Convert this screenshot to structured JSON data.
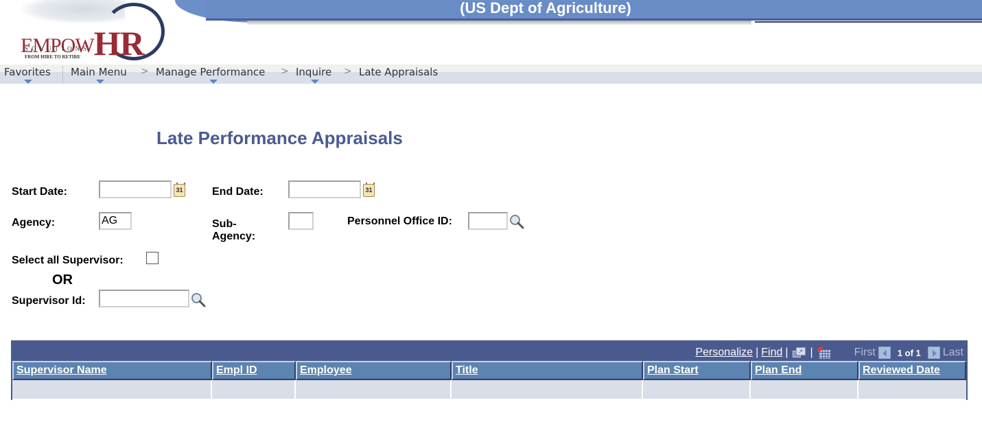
{
  "header": {
    "org_title": "(US Dept of Agriculture)",
    "logo": {
      "brand_prefix": "EMPOW",
      "brand_suffix": "HR",
      "subtitle": "SOLUTIONS",
      "tagline": "FROM HIRE TO RETIRE"
    }
  },
  "breadcrumb": {
    "items": [
      {
        "label": "Favorites",
        "has_menu": true
      },
      {
        "label": "Main Menu",
        "has_menu": true
      },
      {
        "label": "Manage Performance",
        "has_menu": true
      },
      {
        "label": "Inquire",
        "has_menu": true
      },
      {
        "label": "Late Appraisals",
        "has_menu": false
      }
    ],
    "separator": ">"
  },
  "page": {
    "title": "Late Performance Appraisals"
  },
  "form": {
    "start_date": {
      "label": "Start Date:",
      "value": "",
      "icon": "calendar-icon",
      "icon_text": "31"
    },
    "end_date": {
      "label": "End Date:",
      "value": "",
      "icon": "calendar-icon",
      "icon_text": "31"
    },
    "agency": {
      "label": "Agency:",
      "value": "AG"
    },
    "sub_agency": {
      "label_line1": "Sub-",
      "label_line2": "Agency:",
      "value": ""
    },
    "personnel_office_id": {
      "label": "Personnel Office ID:",
      "value": "",
      "icon": "lookup-icon"
    },
    "select_all_supervisor": {
      "label": "Select all Supervisor:",
      "checked": false
    },
    "or_label": "OR",
    "supervisor_id": {
      "label": "Supervisor Id:",
      "value": "",
      "icon": "lookup-icon"
    }
  },
  "grid": {
    "toolbar": {
      "personalize": "Personalize",
      "find": "Find",
      "separator": "|",
      "first": "First",
      "page_status": "1 of 1",
      "last": "Last"
    },
    "columns": [
      "Supervisor Name",
      "Empl ID",
      "Employee",
      "Title",
      "Plan Start",
      "Plan End",
      "Reviewed Date"
    ],
    "rows": [
      [
        "",
        "",
        "",
        "",
        "",
        "",
        ""
      ]
    ]
  },
  "colors": {
    "banner": "#6b8fc8",
    "title": "#4b5b91",
    "grid_header": "#4b5a8e",
    "column_header": "#5b84b1",
    "row_bg": "#d9dee8"
  }
}
